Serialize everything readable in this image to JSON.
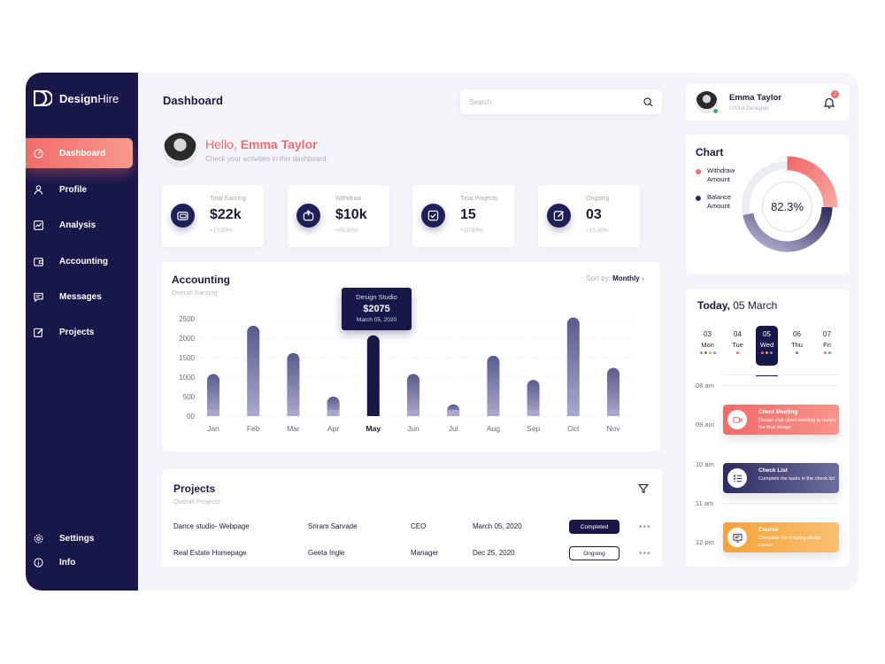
{
  "brand": {
    "name_bold": "Design",
    "name_thin": "Hire"
  },
  "sidebar": {
    "items": [
      {
        "label": "Dashboard",
        "icon": "dashboard-icon",
        "active": true
      },
      {
        "label": "Profile",
        "icon": "user-icon"
      },
      {
        "label": "Analysis",
        "icon": "chart-icon"
      },
      {
        "label": "Accounting",
        "icon": "wallet-icon"
      },
      {
        "label": "Messages",
        "icon": "message-icon"
      },
      {
        "label": "Projects",
        "icon": "edit-icon"
      }
    ],
    "bottom": [
      {
        "label": "Settings",
        "icon": "gear-icon"
      },
      {
        "label": "Info",
        "icon": "info-icon"
      }
    ]
  },
  "header": {
    "title": "Dashboard",
    "search_placeholder": "Search"
  },
  "greeting": {
    "hello": "Hello, ",
    "name": "Emma Taylor",
    "subtitle": "Check your activities in this dashboard."
  },
  "stats": [
    {
      "label": "Total Earning",
      "value": "$22k",
      "change": "+10.80%",
      "icon": "wallet-icon"
    },
    {
      "label": "Withdraw",
      "value": "$10k",
      "change": "+05.80%",
      "icon": "withdraw-icon"
    },
    {
      "label": "Total Projects",
      "value": "15",
      "change": "+10.80%",
      "icon": "checkbox-icon"
    },
    {
      "label": "Ongoing",
      "value": "03",
      "change": "+10.80%",
      "icon": "edit-icon"
    }
  ],
  "accounting": {
    "title": "Accounting",
    "subtitle": "Overall Earning",
    "sort_label": "Sort by:",
    "sort_value": "Monthly",
    "tooltip": {
      "name": "Design Studio",
      "value": "$2075",
      "date": "March 05, 2020"
    }
  },
  "chart_data": {
    "type": "bar",
    "categories": [
      "Jan",
      "Feb",
      "Mar",
      "Apr",
      "May",
      "Jun",
      "Jul",
      "Aug",
      "Sep",
      "Oct",
      "Nov"
    ],
    "values": [
      1080,
      2320,
      1620,
      500,
      2075,
      1080,
      300,
      1550,
      930,
      2530,
      1240
    ],
    "highlight": "May",
    "yticks": [
      "00",
      "500",
      "1000",
      "1500",
      "2000",
      "2500"
    ],
    "ylim": [
      0,
      2500
    ],
    "grid": true,
    "colors": {
      "bar": "#6e6e9e",
      "highlight": "#17174a"
    }
  },
  "projects": {
    "title": "Projects",
    "subtitle": "Overall Projects",
    "rows": [
      {
        "name": "Dance studio- Webpage",
        "person": "Sriram Sarvade",
        "role": "CEO",
        "date": "March 05, 2020",
        "status": "Completed"
      },
      {
        "name": "Real Estate Homepage",
        "person": "Geeta Ingle",
        "role": "Manager",
        "date": "Dec 25, 2020",
        "status": "Ongoing"
      }
    ]
  },
  "user": {
    "name": "Emma Taylor",
    "role": "UX/UI Designer",
    "notifications": "2"
  },
  "donut": {
    "title": "Chart",
    "center": "82.3%",
    "withdraw_value": 0.18,
    "legend": [
      {
        "label_1": "Withdraw",
        "label_2": "Amount",
        "color": "#f26b6b"
      },
      {
        "label_1": "Balance",
        "label_2": "Amount",
        "color": "#2c2c5a"
      }
    ]
  },
  "calendar": {
    "title_bold": "Today,",
    "title_rest": " 05 March",
    "days": [
      {
        "num": "03",
        "name": "Mon",
        "dots": [
          "#f26b6b",
          "#6e6e9e",
          "#f6a23a",
          "#6e90f0"
        ]
      },
      {
        "num": "04",
        "name": "Tue",
        "dots": [
          "#f26b6b"
        ]
      },
      {
        "num": "05",
        "name": "Wed",
        "dots": [
          "#f26b6b",
          "#f6a23a",
          "#6e90f0"
        ],
        "active": true
      },
      {
        "num": "06",
        "name": "Thu",
        "dots": [
          "#7b6ee8"
        ]
      },
      {
        "num": "07",
        "name": "Fri",
        "dots": [
          "#f26b6b",
          "#3ec27d"
        ]
      }
    ],
    "times": [
      "08 am",
      "09 am",
      "10 am",
      "11 am",
      "12 pm"
    ],
    "events": [
      {
        "title": "Client Meeting",
        "desc": "Design club client meeting to review the final design",
        "icon": "video-icon",
        "color": "#f26b6b"
      },
      {
        "title": "Check List",
        "desc": "Complete the tasks in the check list",
        "icon": "checklist-icon",
        "color": "#454580"
      },
      {
        "title": "Course",
        "desc": "Complete the ongoing design course",
        "icon": "course-icon",
        "color": "#f6a23a"
      }
    ]
  }
}
